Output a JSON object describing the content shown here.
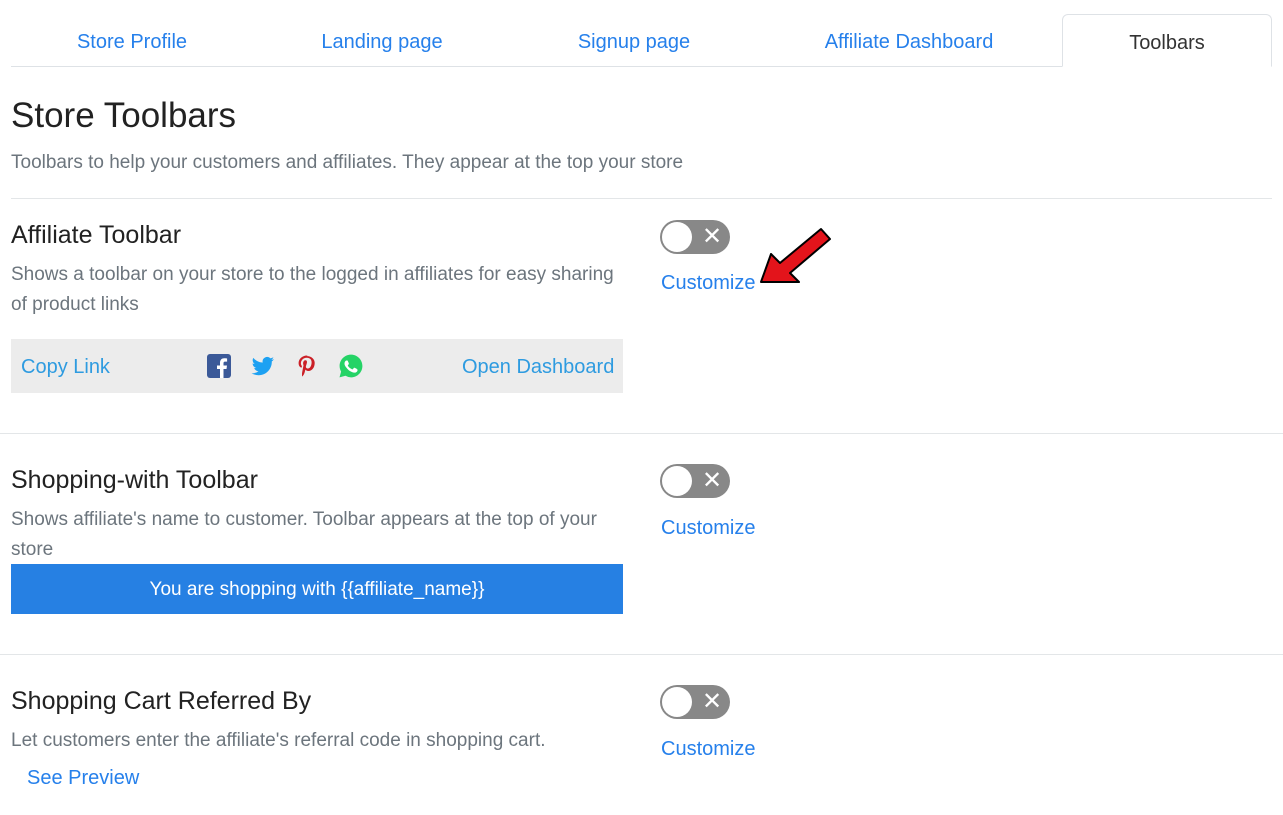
{
  "tabs": [
    {
      "label": "Store Profile",
      "active": false
    },
    {
      "label": "Landing page",
      "active": false
    },
    {
      "label": "Signup page",
      "active": false
    },
    {
      "label": "Affiliate Dashboard",
      "active": false
    },
    {
      "label": "Toolbars",
      "active": true
    }
  ],
  "page": {
    "title": "Store Toolbars",
    "subtitle": "Toolbars to help your customers and affiliates. They appear at the top your store"
  },
  "sections": [
    {
      "title": "Affiliate Toolbar",
      "description": "Shows a toolbar on your store to the logged in affiliates for easy sharing of product links",
      "toggle_on": false,
      "customize_label": "Customize",
      "preview": {
        "copy_link_label": "Copy Link",
        "open_dashboard_label": "Open Dashboard",
        "icons": [
          "facebook-icon",
          "twitter-icon",
          "pinterest-icon",
          "whatsapp-icon"
        ]
      }
    },
    {
      "title": "Shopping-with Toolbar",
      "description": "Shows affiliate's name to customer. Toolbar appears at the top of your store",
      "toggle_on": false,
      "customize_label": "Customize",
      "preview_text": "You are shopping with {{affiliate_name}}"
    },
    {
      "title": "Shopping Cart Referred By",
      "description": "Let customers enter the affiliate's referral code in shopping cart.",
      "toggle_on": false,
      "customize_label": "Customize",
      "see_preview_label": "See Preview"
    }
  ],
  "colors": {
    "link": "#2680eb",
    "toggle_off": "#888888",
    "highlight_bar": "#2680e3",
    "annotation_arrow": "#e3141b"
  }
}
